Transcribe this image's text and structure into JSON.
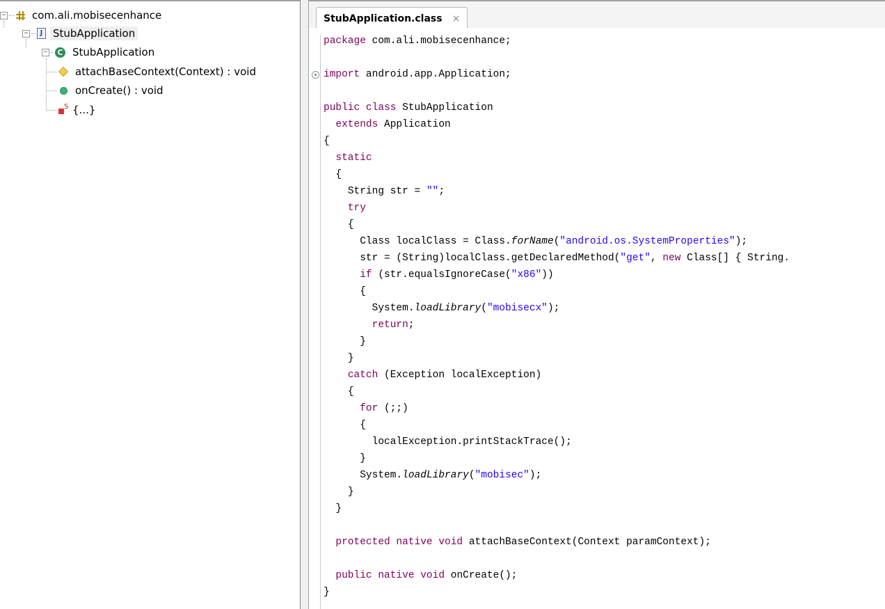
{
  "tree": {
    "package": "com.ali.mobisecenhance",
    "file": "StubApplication",
    "class": "StubApplication",
    "members": [
      {
        "label": "attachBaseContext(Context) : void",
        "icon": "protected-method-icon"
      },
      {
        "label": "onCreate() : void",
        "icon": "public-method-icon"
      },
      {
        "label": "{...}",
        "icon": "static-initializer-icon"
      }
    ]
  },
  "editor": {
    "tab_label": "StubApplication.class",
    "tab_close": "×",
    "fold_symbol": "+",
    "code": {
      "l1a": "package",
      "l1b": " com.ali.mobisecenhance;",
      "l2a": "import",
      "l2b": " android.app.Application;",
      "l3a": "public class",
      "l3b": " StubApplication",
      "l4a": "extends",
      "l4b": " Application",
      "l5": "{",
      "l6": "static",
      "l7": "{",
      "l8a": "String str = ",
      "l8b": "\"\"",
      "l8c": ";",
      "l9": "try",
      "l10": "{",
      "l11a": "Class localClass = Class.",
      "l11b": "forName",
      "l11c": "(",
      "l11d": "\"android.os.SystemProperties\"",
      "l11e": ");",
      "l12a": "str = (String)localClass.getDeclaredMethod(",
      "l12b": "\"get\"",
      "l12c": ", ",
      "l12d": "new",
      "l12e": " Class[] { String.",
      "l13a": "if",
      "l13b": " (str.equalsIgnoreCase(",
      "l13c": "\"x86\"",
      "l13d": "))",
      "l14": "{",
      "l15a": "System.",
      "l15b": "loadLibrary",
      "l15c": "(",
      "l15d": "\"mobisecx\"",
      "l15e": ");",
      "l16a": "return",
      "l16b": ";",
      "l17": "}",
      "l18": "}",
      "l19a": "catch",
      "l19b": " (Exception localException)",
      "l20": "{",
      "l21a": "for",
      "l21b": " (;;)",
      "l22": "{",
      "l23": "localException.printStackTrace();",
      "l24": "}",
      "l25a": "System.",
      "l25b": "loadLibrary",
      "l25c": "(",
      "l25d": "\"mobisec\"",
      "l25e": ");",
      "l26": "}",
      "l27": "}",
      "l28a": "protected native void",
      "l28b": " attachBaseContext(Context paramContext);",
      "l29a": "public native void",
      "l29b": " onCreate();",
      "l30": "}"
    }
  },
  "colors": {
    "keyword": "#7f0055",
    "string": "#2a00ff",
    "selection": "#eeeeee"
  }
}
